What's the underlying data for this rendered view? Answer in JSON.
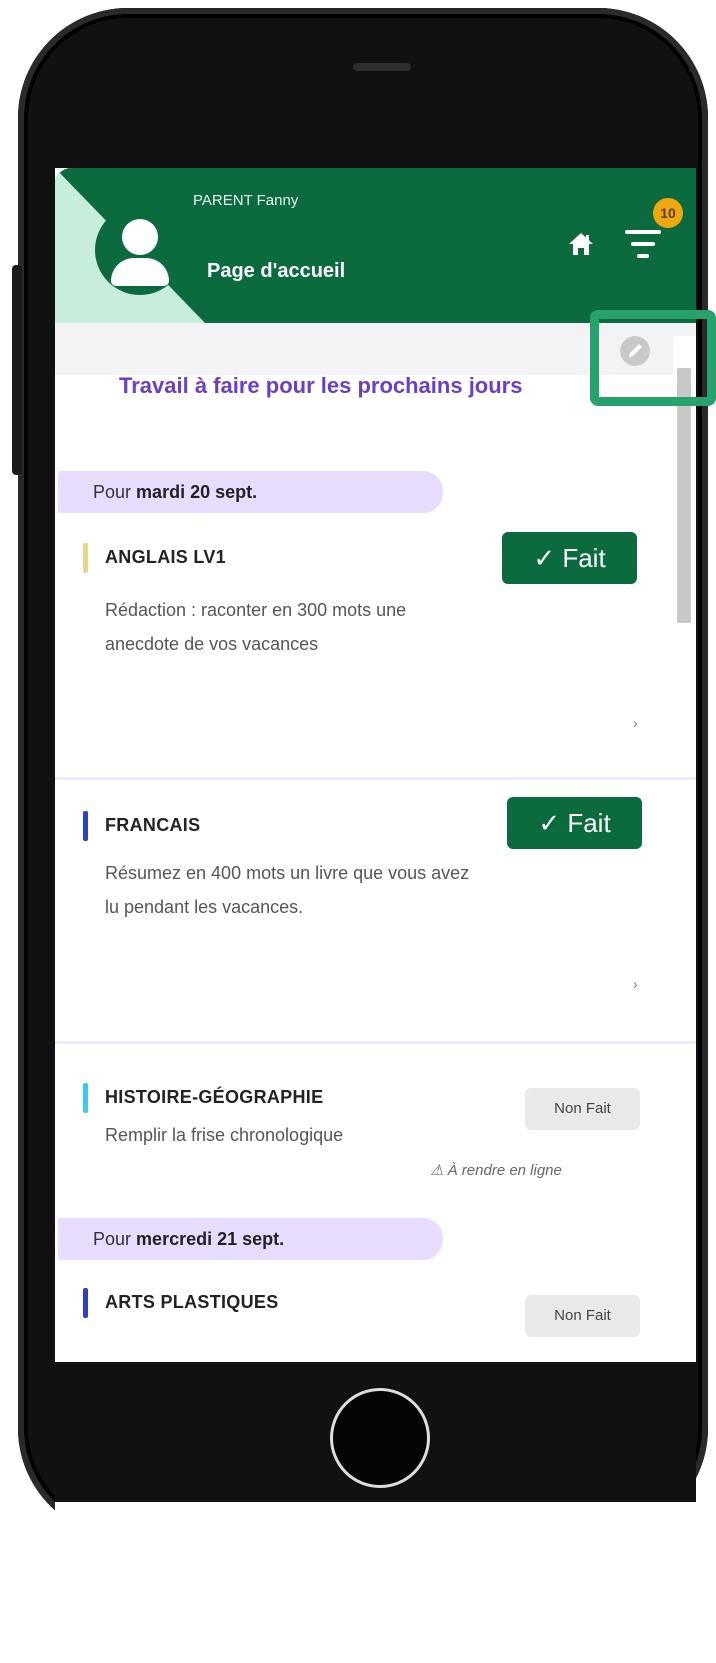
{
  "header": {
    "user_name": "PARENT Fanny",
    "page_title": "Page d'accueil",
    "notification_count": "10"
  },
  "section_title": "Travail à faire pour les prochains jours",
  "groups": [
    {
      "prefix": "Pour",
      "date": "mardi 20 sept.",
      "tasks": [
        {
          "subject": "ANGLAIS LV1",
          "color": "#e2d98a",
          "status": "Fait",
          "done": true,
          "desc_1": "Rédaction : raconter en 300 mots une",
          "desc_2": "anecdote de vos vacances"
        },
        {
          "subject": "FRANCAIS",
          "color": "#2f3fc8",
          "status": "Fait",
          "done": true,
          "desc_1": "Résumez en 400 mots un livre que vous avez",
          "desc_2": "lu pendant les vacances."
        },
        {
          "subject": "HISTOIRE-GÉOGRAPHIE",
          "color": "#41c8f0",
          "status": "Non Fait",
          "done": false,
          "desc_1": "Remplir la frise chronologique",
          "online": "À rendre en ligne"
        }
      ]
    },
    {
      "prefix": "Pour",
      "date": "mercredi 21 sept.",
      "tasks": [
        {
          "subject": "ARTS PLASTIQUES",
          "color": "#2f3fc8",
          "status": "Non Fait",
          "done": false
        }
      ]
    }
  ],
  "colors": {
    "brand_green": "#0b6b3f",
    "accent_purple": "#6a3fc5",
    "pill_lilac": "#e8dcff",
    "highlight": "#28a26c",
    "badge": "#f1a80e"
  }
}
